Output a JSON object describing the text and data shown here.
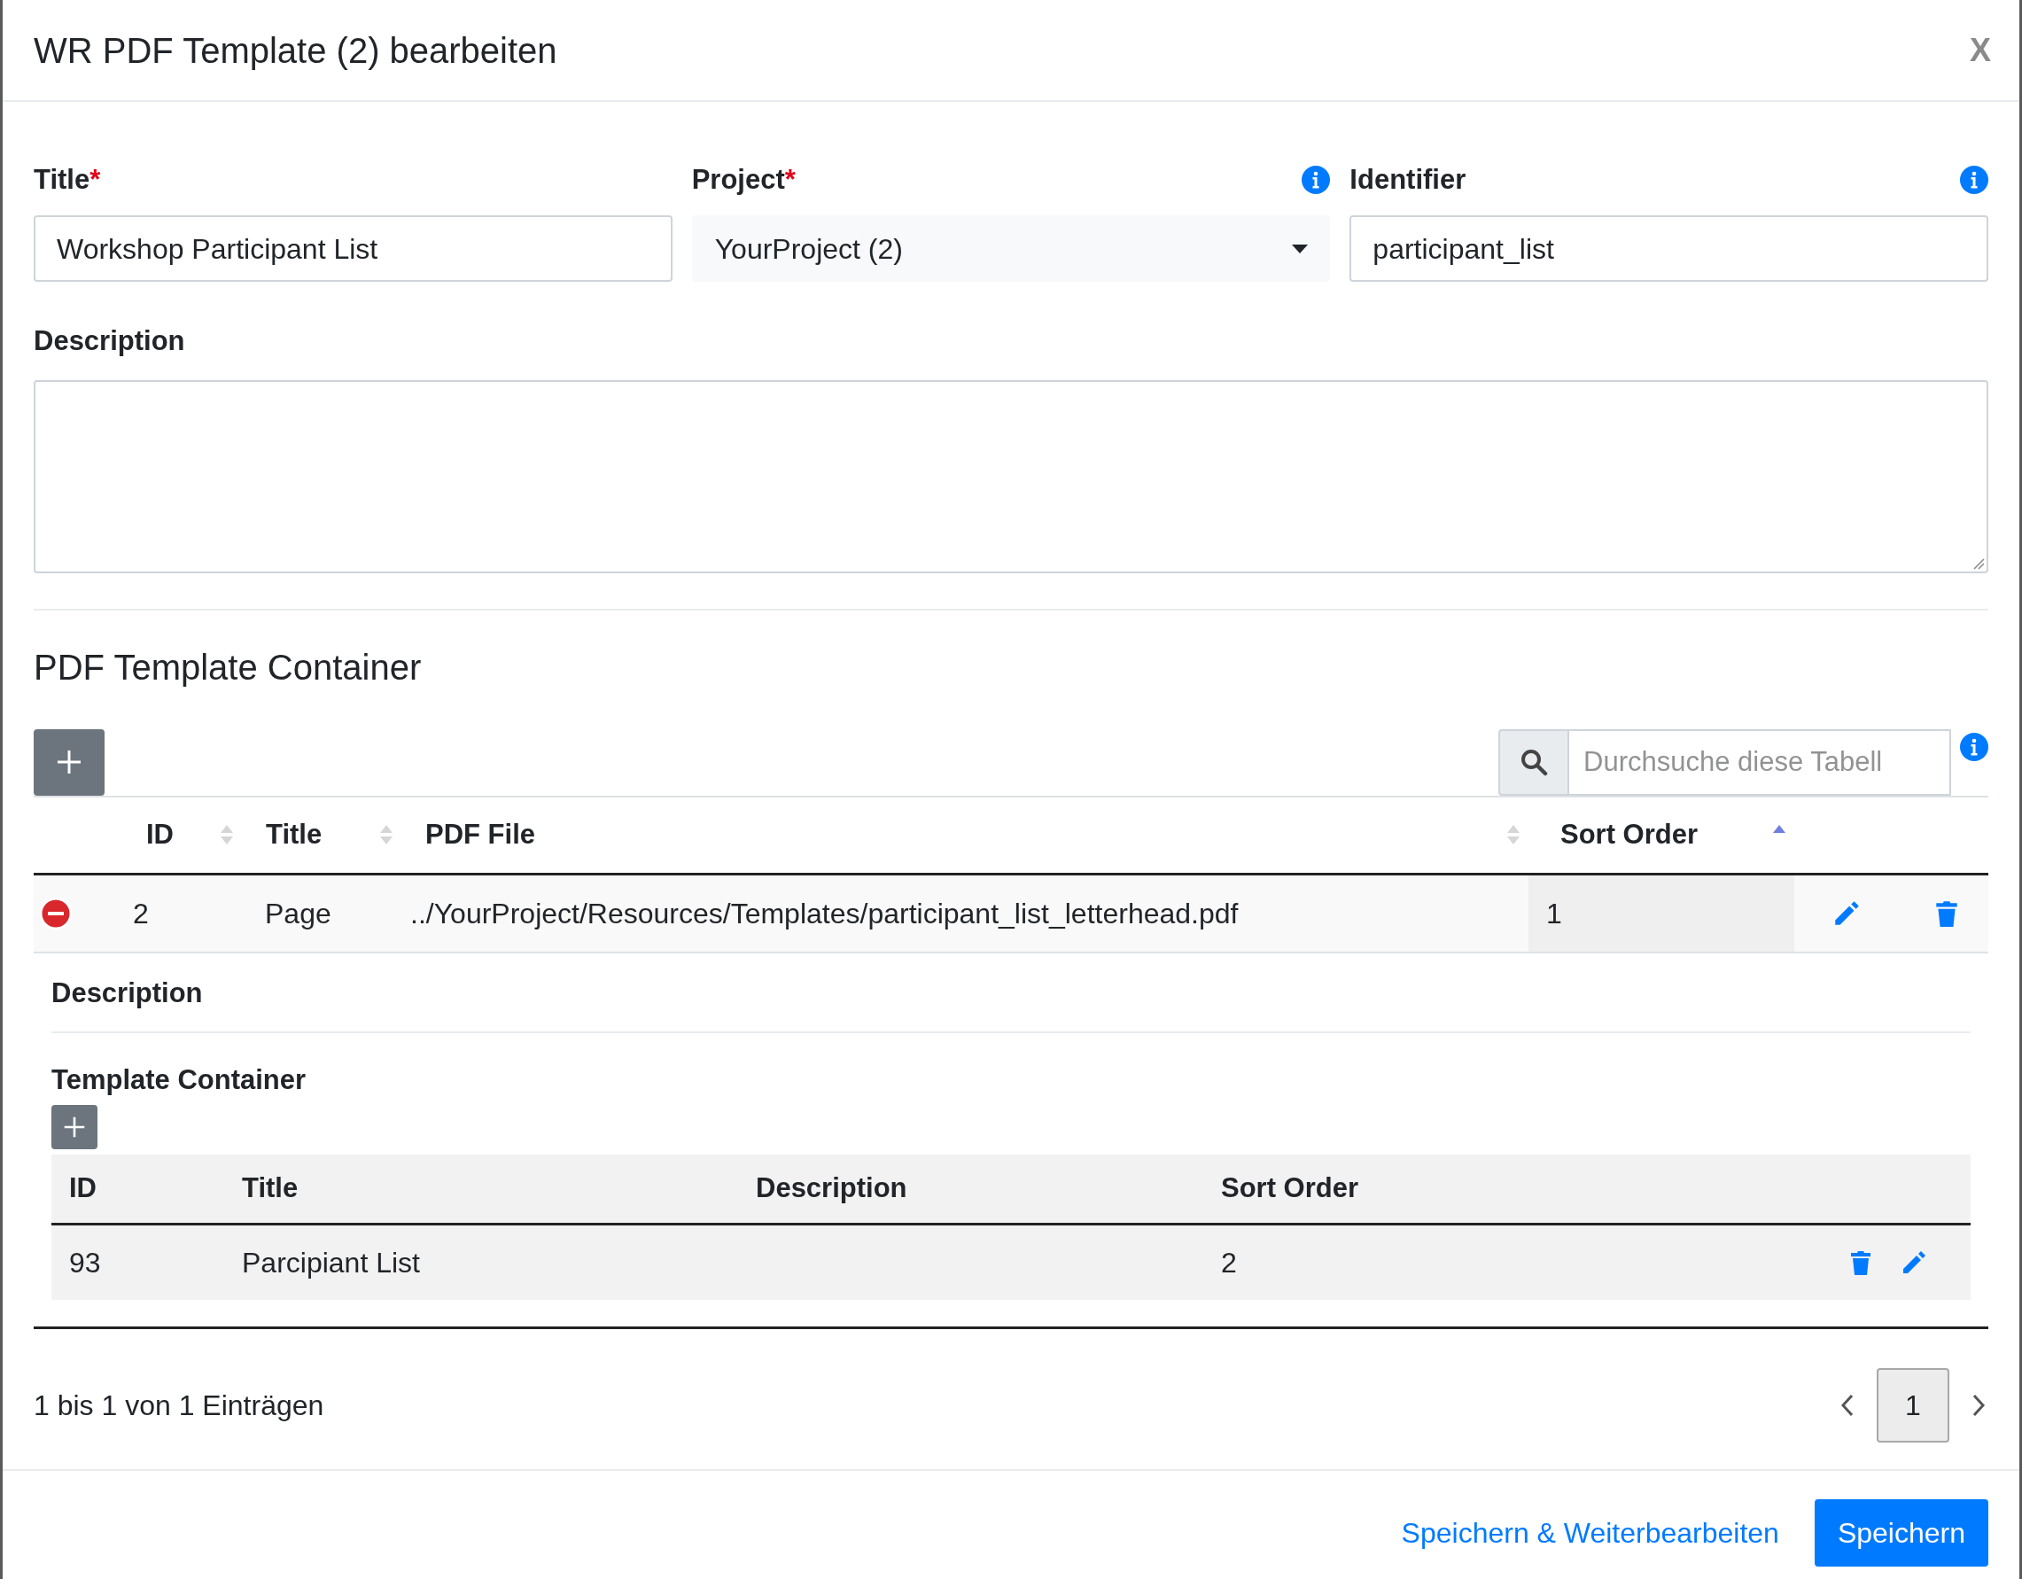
{
  "modal": {
    "title": "WR PDF Template (2) bearbeiten",
    "close": "X"
  },
  "fields": [
    {
      "kind": "text",
      "label": "Title",
      "required_mark": "*",
      "info": false,
      "value": "Workshop Participant List"
    },
    {
      "kind": "select",
      "label": "Project",
      "required_mark": "*",
      "info": true,
      "value": "YourProject (2)"
    },
    {
      "kind": "text",
      "label": "Identifier",
      "info": true,
      "value": "participant_list"
    }
  ],
  "description": {
    "label": "Description"
  },
  "container": {
    "heading": "PDF Template Container",
    "search": {
      "placeholder": "Durchsuche diese Tabell"
    },
    "columns": [
      {
        "label": "ID",
        "sorted": false
      },
      {
        "label": "Title",
        "sorted": false
      },
      {
        "label": "PDF File",
        "sorted": false
      },
      {
        "label": "Sort Order",
        "sorted": true
      }
    ],
    "rows": [
      {
        "expanded": true,
        "id": "2",
        "title": "Page",
        "pdf_file": "../YourProject/Resources/Templates/participant_list_letterhead.pdf",
        "sort_order": "1",
        "detail": {
          "description_label": "Description",
          "sub_heading": "Template Container",
          "columns": [
            "ID",
            "Title",
            "Description",
            "Sort Order"
          ],
          "rows": [
            {
              "id": "93",
              "title": "Parcipiant List",
              "sort_order": "2"
            }
          ]
        }
      }
    ],
    "info": "1 bis 1 von 1 Einträgen",
    "pages": [
      {
        "label": "1",
        "selected": true
      }
    ]
  },
  "footer": {
    "buttons": [
      {
        "kind": "link",
        "label": "Speichern & Weiterbearbeiten"
      },
      {
        "kind": "primary",
        "label": "Speichern"
      }
    ]
  }
}
